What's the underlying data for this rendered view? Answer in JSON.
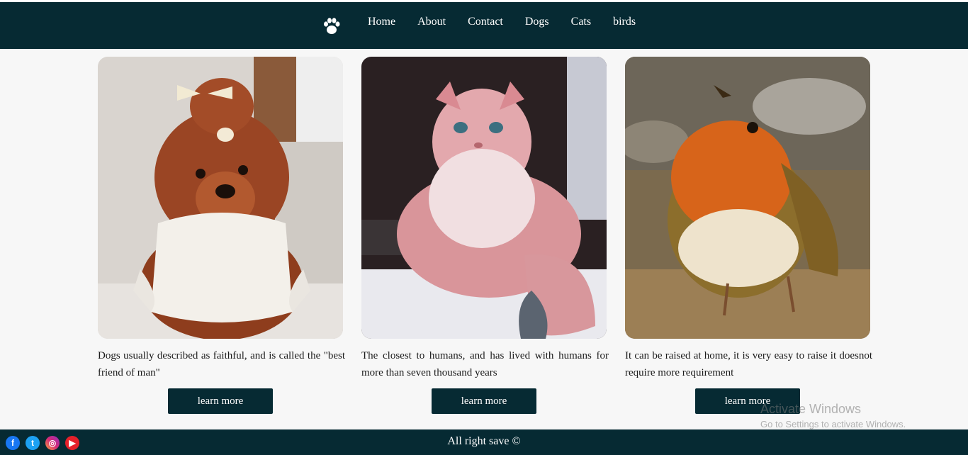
{
  "nav": {
    "logo_icon": "paw-icon",
    "items": [
      "Home",
      "About",
      "Contact",
      "Dogs",
      "Cats",
      "birds"
    ]
  },
  "cards": [
    {
      "image": "poodle-dog-photo",
      "text": "Dogs usually described as faithful, and is called the \"best friend of man\"",
      "button": "learn more"
    },
    {
      "image": "pink-cat-photo",
      "text": "The closest to humans, and has lived with humans for more than seven thousand years",
      "button": "learn more"
    },
    {
      "image": "robin-bird-photo",
      "text": "It can be raised at home, it is very easy to raise it doesnot require more requirement",
      "button": "learn more"
    }
  ],
  "footer": {
    "copyright": "All right save ©",
    "social": [
      "facebook-icon",
      "twitter-icon",
      "instagram-icon",
      "youtube-icon"
    ]
  },
  "watermark": {
    "title": "Activate Windows",
    "subtitle": "Go to Settings to activate Windows."
  },
  "colors": {
    "navbar": "#062a33",
    "background": "#f7f7f7",
    "button": "#062a33"
  }
}
